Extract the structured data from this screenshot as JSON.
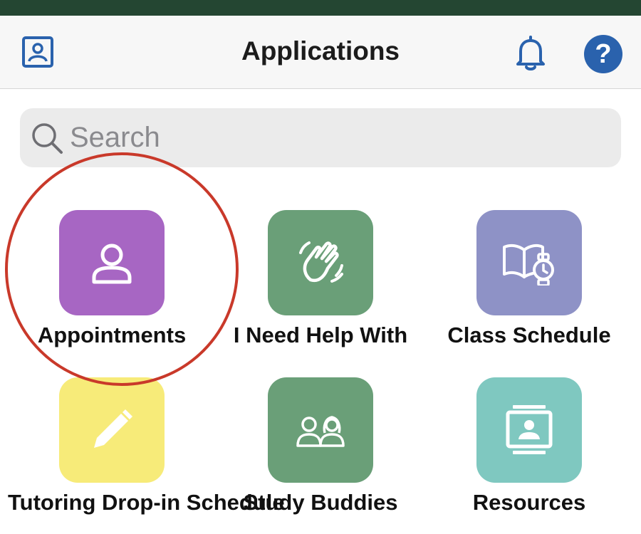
{
  "header": {
    "title": "Applications"
  },
  "icons": {
    "profile": "profile-card-icon",
    "notifications": "bell-icon",
    "help": "question-mark-icon",
    "search": "search-icon"
  },
  "help_glyph": "?",
  "search": {
    "placeholder": "Search"
  },
  "apps": [
    {
      "label": "Appointments",
      "color": "#a766c3",
      "icon": "person-icon"
    },
    {
      "label": "I Need Help With",
      "color": "#6a9f78",
      "icon": "waving-hand-icon"
    },
    {
      "label": "Class Schedule",
      "color": "#8e92c6",
      "icon": "book-watch-icon"
    },
    {
      "label": "Tutoring Drop-in Schedule",
      "color": "#f7eb79",
      "icon": "pencil-icon"
    },
    {
      "label": "Study Buddies",
      "color": "#6a9f78",
      "icon": "two-people-icon"
    },
    {
      "label": "Resources",
      "color": "#7fc8c0",
      "icon": "directory-icon"
    }
  ],
  "colors": {
    "status_bar": "#244632",
    "accent_blue": "#2a62ad",
    "highlight_ring": "#c9392a"
  }
}
